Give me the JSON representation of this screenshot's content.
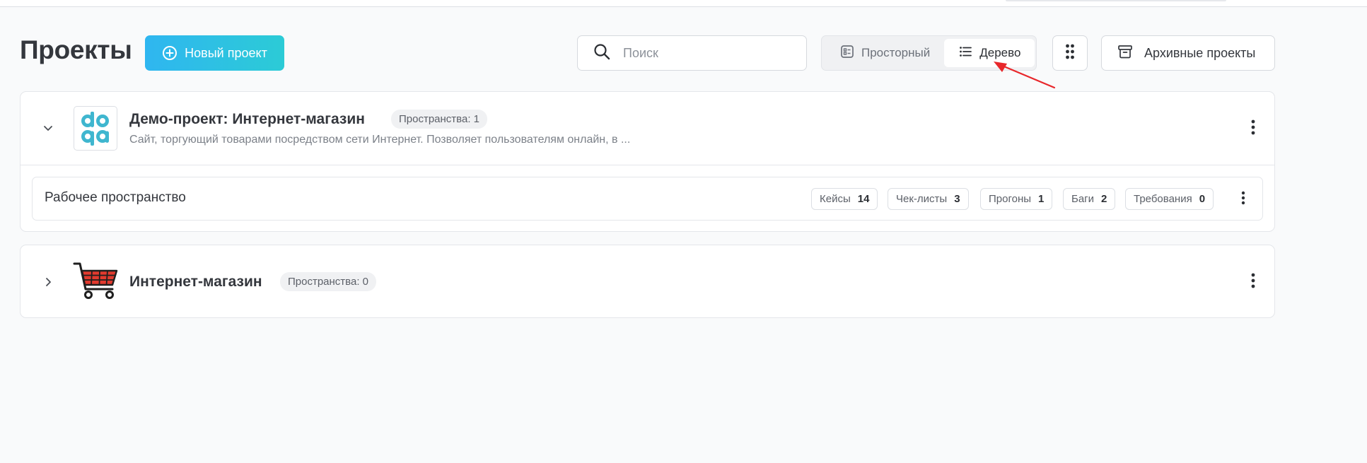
{
  "header": {
    "title": "Проекты",
    "new_project_label": "Новый проект",
    "search_placeholder": "Поиск",
    "view_toggle": {
      "options": [
        {
          "label": "Просторный",
          "icon": "list-card-icon",
          "active": false
        },
        {
          "label": "Дерево",
          "icon": "tree-list-icon",
          "active": true
        }
      ]
    },
    "grid_menu_icon": "dots-grid-icon",
    "archive_label": "Архивные проекты"
  },
  "projects": [
    {
      "title": "Демо-проект: Интернет-магазин",
      "spaces_badge": "Пространства: 1",
      "description": "Сайт, торгующий товарами посредством сети Интернет. Позволяет пользователям онлайн, в ...",
      "expanded": true,
      "logo": "doqa-logo",
      "workspaces": [
        {
          "title": "Рабочее пространство",
          "stats": [
            {
              "label": "Кейсы",
              "value": "14"
            },
            {
              "label": "Чек-листы",
              "value": "3"
            },
            {
              "label": "Прогоны",
              "value": "1"
            },
            {
              "label": "Баги",
              "value": "2"
            },
            {
              "label": "Требования",
              "value": "0"
            }
          ]
        }
      ]
    },
    {
      "title": "Интернет-магазин",
      "spaces_badge": "Пространства: 0",
      "expanded": false,
      "logo": "shopping-cart-logo"
    }
  ],
  "colors": {
    "accent_gradient_start": "#2fb6f0",
    "accent_gradient_end": "#2ccbd6",
    "annotation_arrow": "#e8272b",
    "doqa_logo": "#3fb6cf",
    "cart_red": "#e23a2e"
  }
}
